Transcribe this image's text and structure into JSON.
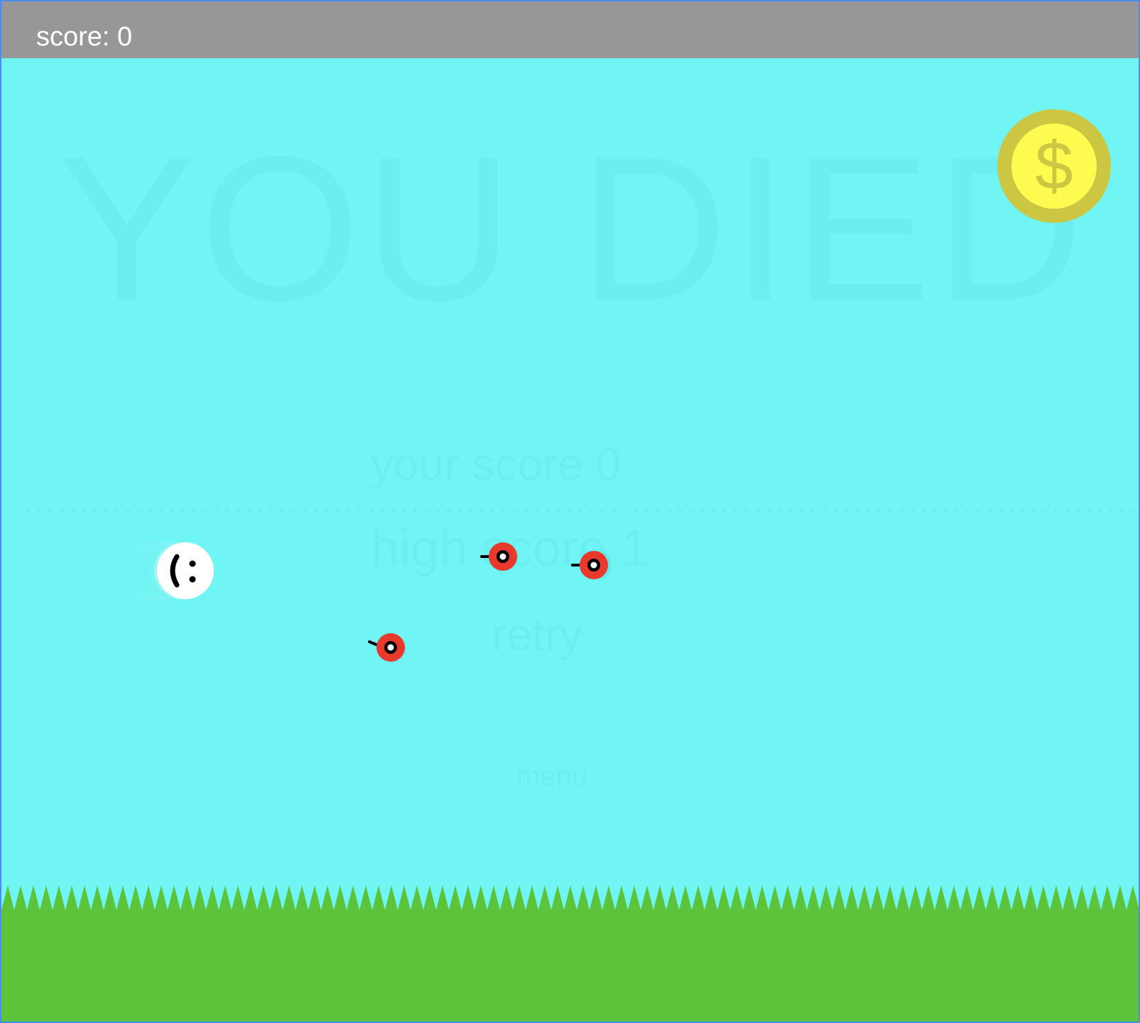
{
  "hud": {
    "score_label": "score: 0"
  },
  "scene": {
    "background_color": "#70f5f4",
    "ground_color": "#5cc33b",
    "score_bar_color": "#979797"
  },
  "coin": {
    "icon": "dollar-coin-icon",
    "glyph": "$",
    "outer_color": "#cbc743",
    "inner_color": "#fdfb4f"
  },
  "player": {
    "icon": "smiley-ball-icon",
    "face": "( :",
    "color": "#ffffff"
  },
  "enemies": [
    {
      "icon": "red-eyeball-enemy-icon",
      "color": "#e8392c"
    },
    {
      "icon": "red-eyeball-enemy-icon",
      "color": "#e8392c"
    },
    {
      "icon": "red-eyeball-enemy-icon",
      "color": "#e8392c"
    }
  ]
}
